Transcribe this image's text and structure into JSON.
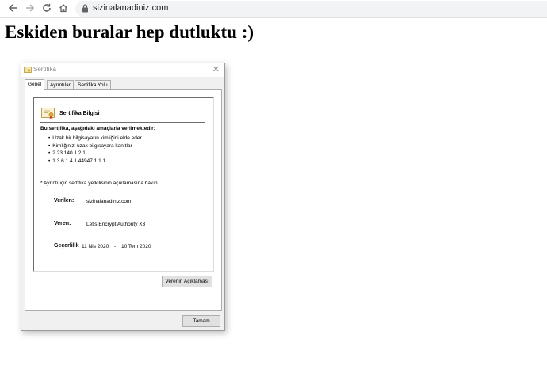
{
  "browser": {
    "url": "sizinalanadiniz.com"
  },
  "page": {
    "heading": "Eskiden buralar hep dutluktu :)"
  },
  "dialog": {
    "title": "Sertifika",
    "tabs": [
      {
        "label": "Genel",
        "active": true
      },
      {
        "label": "Ayrıntılar",
        "active": false
      },
      {
        "label": "Sertifika Yolu",
        "active": false
      }
    ],
    "cert_info_title": "Sertifika Bilgisi",
    "purposes_heading": "Bu sertifika, aşağıdaki amaçlarla verilmektedir:",
    "purposes": [
      "Uzak bir bilgisayarın kimliğini elde eder",
      "Kimliğinizi uzak bilgisayara kanıtlar",
      "2.23.140.1.2.1",
      "1.3.6.1.4.1.44947.1.1.1"
    ],
    "note": "* Ayrıntı için sertifika yetkilisinin açıklamasına bakın.",
    "issued_to_label": "Verilen:",
    "issued_to_value": "sizinalanadiniz.com",
    "issued_by_label": "Veren:",
    "issued_by_value": "Let's Encrypt Authority X3",
    "validity_label": "Geçerlilik",
    "validity_from": "11 Nis 2020",
    "validity_sep": "-",
    "validity_to": "10 Tem 2020",
    "issuer_statement_button": "Verenin Açıklaması",
    "ok_button": "Tamam"
  }
}
